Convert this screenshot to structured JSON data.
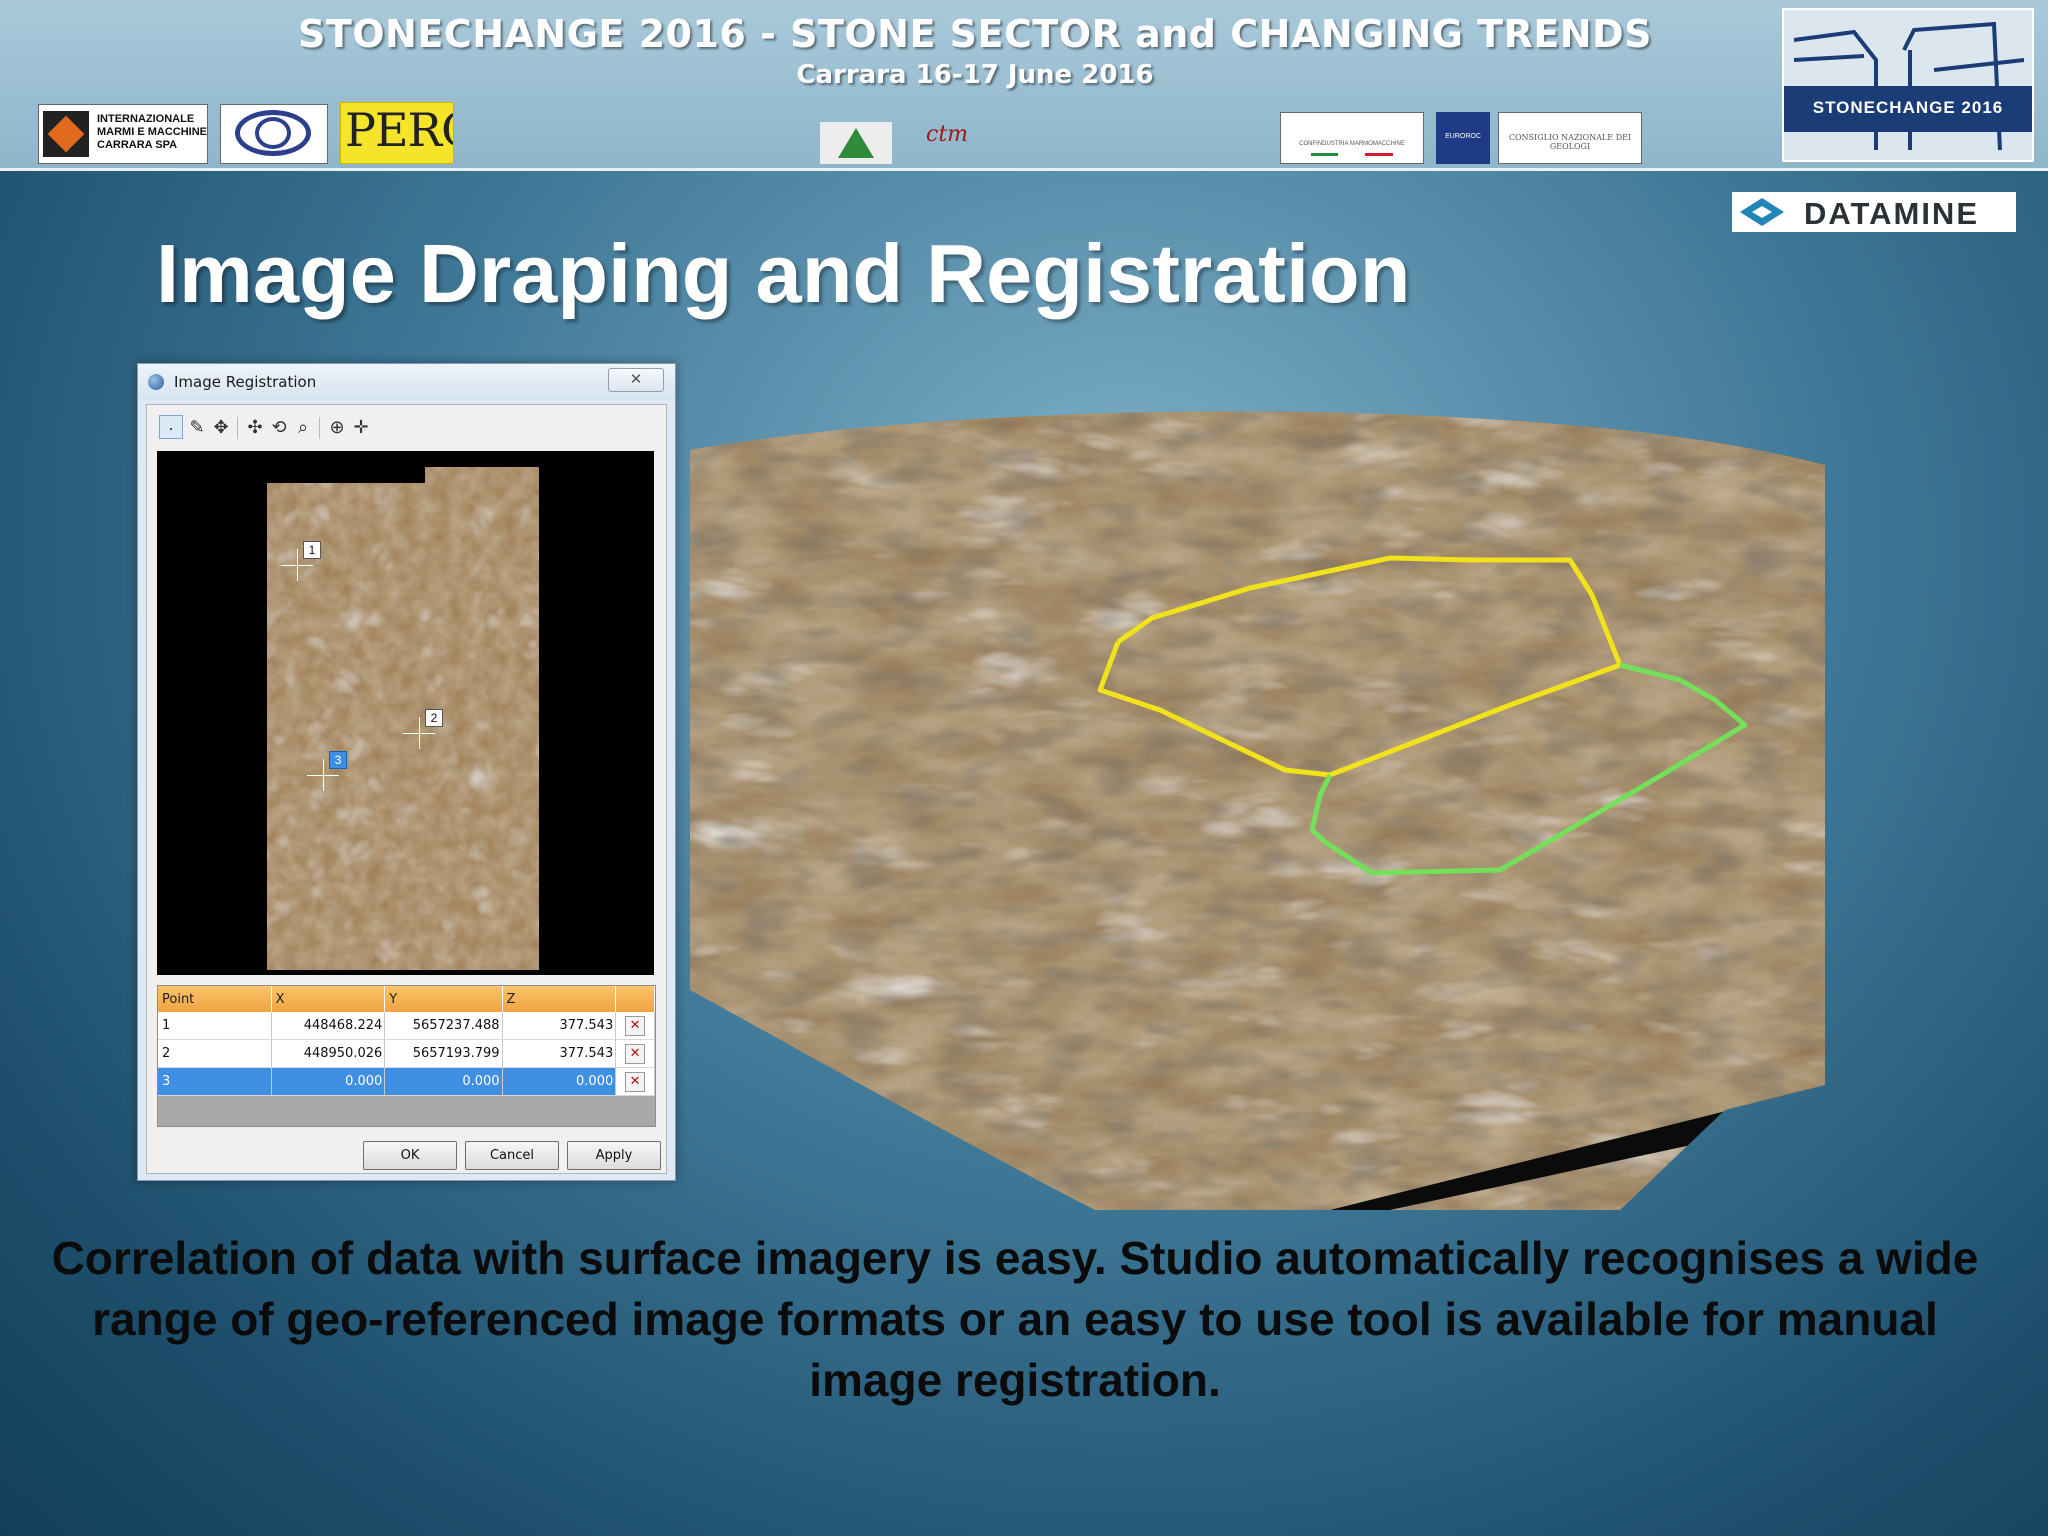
{
  "header": {
    "conference_title": "STONECHANGE 2016 - STONE SECTOR and CHANGING TRENDS",
    "conference_subtitle": "Carrara 16-17 June 2016",
    "logos": {
      "imm_text": "INTERNAZIONALE MARMI E MACCHINE CARRARA SPA",
      "perc": "PERC",
      "ctm": "ctm",
      "confindustria": "CONFINDUSTRIA MARMOMACCHINE",
      "euroroc": "EUROROC",
      "cng": "CONSIGLIO NAZIONALE DEI GEOLOGI",
      "stonechange_badge": "STONECHANGE 2016",
      "datamine": "DATAMINE"
    }
  },
  "slide": {
    "title": "Image Draping and Registration",
    "caption": "Correlation of data with surface imagery is easy. Studio automatically recognises a wide range of geo-referenced image formats or an easy to use tool is available for manual image registration."
  },
  "dialog": {
    "title": "Image Registration",
    "close_glyph": "✕",
    "toolbar_icons": [
      "select-point-icon",
      "pick-icon",
      "move-icon",
      "pan-icon",
      "rotate-icon",
      "zoom-icon",
      "zoom-extents-icon",
      "add-point-icon"
    ],
    "gcp_labels": [
      "1",
      "2",
      "3"
    ],
    "table": {
      "columns": [
        "Point",
        "X",
        "Y",
        "Z"
      ],
      "rows": [
        {
          "point": "1",
          "x": "448468.224",
          "y": "5657237.488",
          "z": "377.543"
        },
        {
          "point": "2",
          "x": "448950.026",
          "y": "5657193.799",
          "z": "377.543"
        },
        {
          "point": "3",
          "x": "0.000",
          "y": "0.000",
          "z": "0.000"
        }
      ],
      "delete_glyph": "✕"
    },
    "buttons": {
      "ok": "OK",
      "cancel": "Cancel",
      "apply": "Apply"
    }
  },
  "colors": {
    "background": "#2d6786",
    "boundary_yellow": "#f2e21b",
    "boundary_green": "#74e05a",
    "grid_header": "#f5b154",
    "selected_row": "#3f8fe2"
  }
}
